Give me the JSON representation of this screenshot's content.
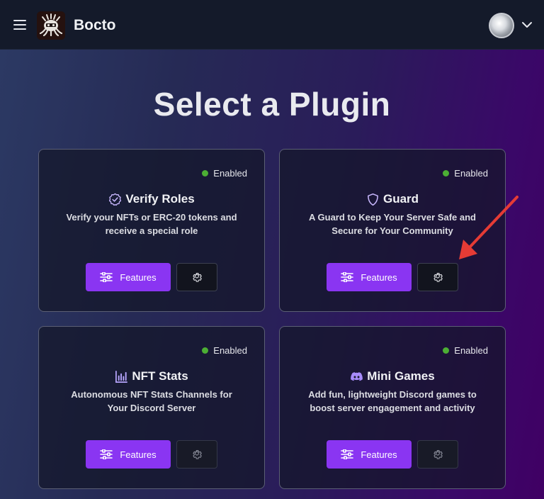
{
  "app": {
    "name": "Bocto"
  },
  "page": {
    "title": "Select a Plugin"
  },
  "plugins": [
    {
      "name": "Verify Roles",
      "description": "Verify your NFTs or ERC-20 tokens and receive a special role",
      "status": "Enabled",
      "features_label": "Features",
      "icon": "check-badge-icon"
    },
    {
      "name": "Guard",
      "description": "A Guard to Keep Your Server Safe and Secure for Your Community",
      "status": "Enabled",
      "features_label": "Features",
      "icon": "shield-icon"
    },
    {
      "name": "NFT Stats",
      "description": "Autonomous NFT Stats Channels for Your Discord Server",
      "status": "Enabled",
      "features_label": "Features",
      "icon": "bar-chart-icon"
    },
    {
      "name": "Mini Games",
      "description": "Add fun, lightweight Discord games to boost server engagement and activity",
      "status": "Enabled",
      "features_label": "Features",
      "icon": "discord-icon"
    }
  ],
  "colors": {
    "accent": "#8a35f2",
    "status_dot": "#4caf34",
    "arrow": "#e53b35",
    "icon_purple": "#a78bfa"
  }
}
